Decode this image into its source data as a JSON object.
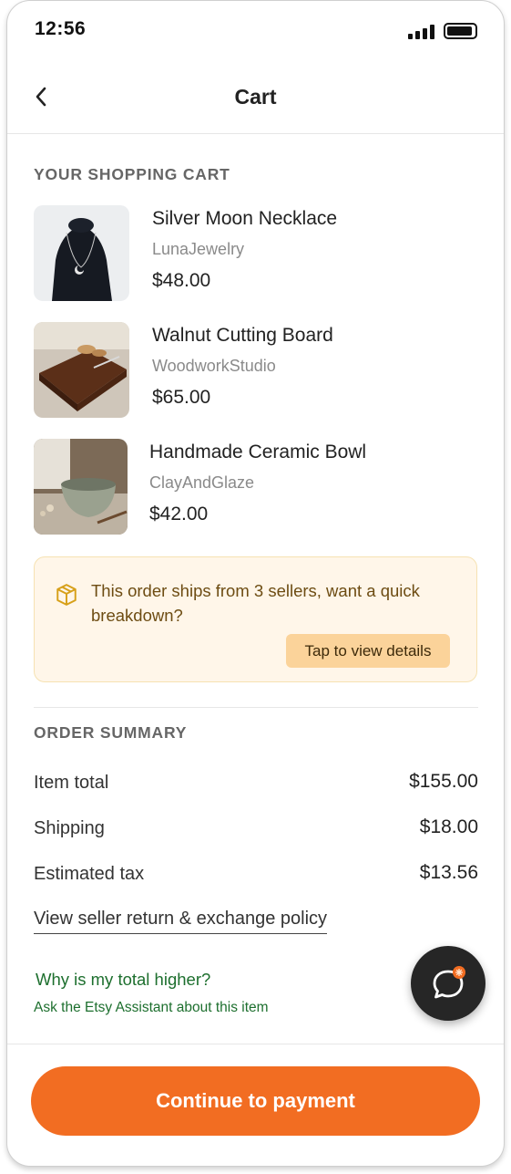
{
  "status_bar": {
    "time": "12:56"
  },
  "header": {
    "title": "Cart"
  },
  "cart": {
    "section_label": "YOUR SHOPPING CART",
    "items": [
      {
        "name": "Silver Moon Necklace",
        "seller": "LunaJewelry",
        "price": "$48.00"
      },
      {
        "name": "Walnut Cutting Board",
        "seller": "WoodworkStudio",
        "price": "$65.00"
      },
      {
        "name": "Handmade Ceramic Bowl",
        "seller": "ClayAndGlaze",
        "price": "$42.00"
      }
    ]
  },
  "notice": {
    "text": "This order ships from 3 sellers, want a quick breakdown?",
    "button_label": "Tap to view details"
  },
  "summary": {
    "section_label": "ORDER SUMMARY",
    "rows": [
      {
        "label": "Item total",
        "value": "$155.00"
      },
      {
        "label": "Shipping",
        "value": "$18.00"
      },
      {
        "label": "Estimated tax",
        "value": "$13.56"
      }
    ],
    "policy_link": "View seller return & exchange policy",
    "why_link": "Why is my total higher?",
    "assistant_link": "Ask the Etsy Assistant about this item"
  },
  "footer": {
    "pay_button": "Continue to payment"
  },
  "colors": {
    "accent": "#f26d22",
    "link_green": "#1d6f2e",
    "notice_bg": "#fff6e9"
  }
}
